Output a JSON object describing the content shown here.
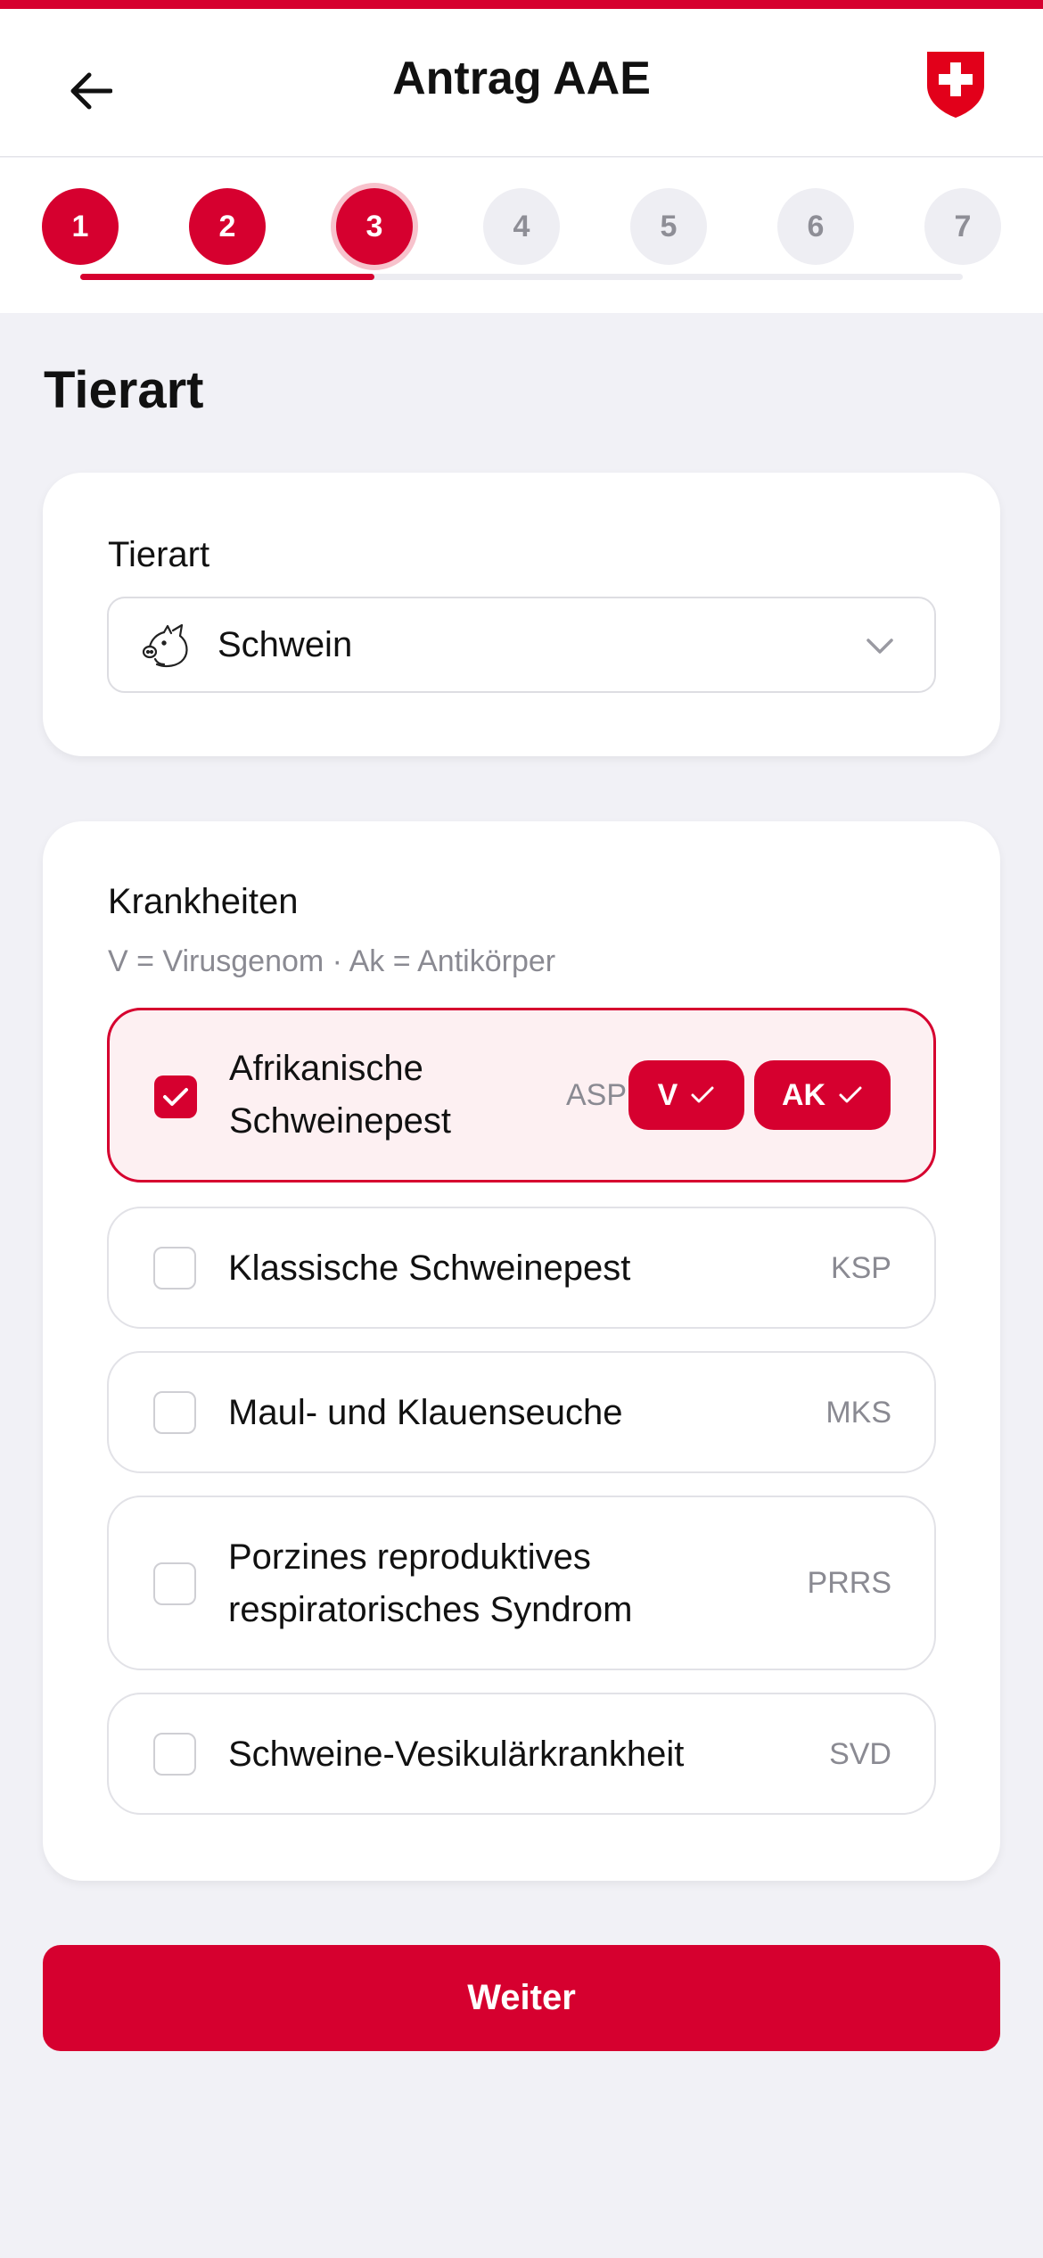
{
  "header": {
    "title": "Antrag AAE",
    "back_icon": "arrow-left-icon",
    "logo_icon": "swiss-cross-shield-icon"
  },
  "stepper": {
    "current_step": 3,
    "steps": [
      "1",
      "2",
      "3",
      "4",
      "5",
      "6",
      "7"
    ]
  },
  "page": {
    "section_title": "Tierart"
  },
  "animal": {
    "label": "Tierart",
    "selected": "Schwein",
    "icon": "pig-icon"
  },
  "diseases": {
    "label": "Krankheiten",
    "legend": "V = Virusgenom · Ak = Antikörper",
    "items": [
      {
        "name_line1": "Afrikanische",
        "name_line2": "Schweinepest",
        "abbr": "ASP",
        "checked": true,
        "tests": [
          "V",
          "AK"
        ]
      },
      {
        "name": "Klassische Schweinepest",
        "abbr": "KSP",
        "checked": false
      },
      {
        "name": "Maul- und Klauenseuche",
        "abbr": "MKS",
        "checked": false
      },
      {
        "name_line1": "Porzines reproduktives",
        "name_line2": "respiratorisches Syndrom",
        "abbr": "PRRS",
        "checked": false
      },
      {
        "name": "Schweine-Vesikulärkrankheit",
        "abbr": "SVD",
        "checked": false
      }
    ]
  },
  "footer": {
    "next_label": "Weiter"
  },
  "colors": {
    "accent": "#D6002F",
    "background": "#F1F1F6"
  }
}
